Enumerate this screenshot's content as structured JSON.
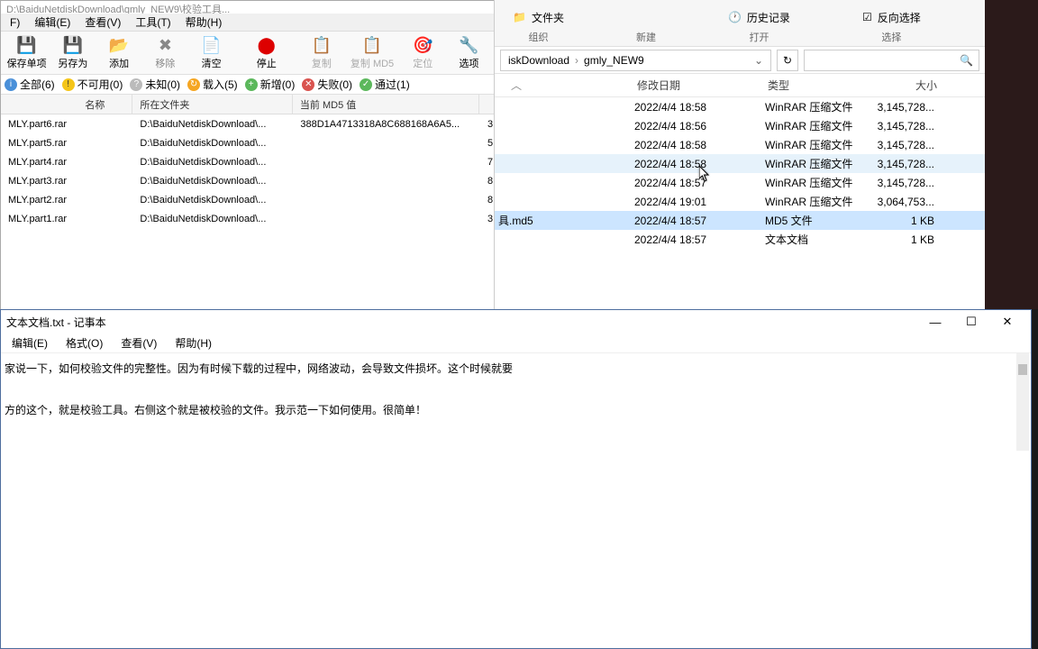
{
  "md5checker": {
    "title_fragment": "D:\\BaiduNetdiskDownload\\gmly_NEW9\\校验工具...",
    "menu": {
      "file": "F)",
      "edit": "编辑(E)",
      "view": "查看(V)",
      "tools": "工具(T)",
      "help": "帮助(H)"
    },
    "toolbar": {
      "save_single": "保存单项",
      "save_as": "另存为",
      "add": "添加",
      "remove": "移除",
      "clear": "清空",
      "stop": "停止",
      "copy": "复制",
      "copy_md5": "复制 MD5",
      "locate": "定位",
      "options": "选项"
    },
    "filter": {
      "all": "全部(6)",
      "na": "不可用(0)",
      "unknown": "未知(0)",
      "loaded": "载入(5)",
      "new": "新增(0)",
      "fail": "失败(0)",
      "pass": "通过(1)"
    },
    "columns": {
      "name": "名称",
      "folder": "所在文件夹",
      "md5": "当前 MD5 值"
    },
    "rows": [
      {
        "name": "MLY.part6.rar",
        "folder": "D:\\BaiduNetdiskDownload\\...",
        "md5": "388D1A4713318A8C688168A6A5...",
        "last": "3"
      },
      {
        "name": "MLY.part5.rar",
        "folder": "D:\\BaiduNetdiskDownload\\...",
        "md5": "",
        "last": "5"
      },
      {
        "name": "MLY.part4.rar",
        "folder": "D:\\BaiduNetdiskDownload\\...",
        "md5": "",
        "last": "7"
      },
      {
        "name": "MLY.part3.rar",
        "folder": "D:\\BaiduNetdiskDownload\\...",
        "md5": "",
        "last": "8"
      },
      {
        "name": "MLY.part2.rar",
        "folder": "D:\\BaiduNetdiskDownload\\...",
        "md5": "",
        "last": "8"
      },
      {
        "name": "MLY.part1.rar",
        "folder": "D:\\BaiduNetdiskDownload\\...",
        "md5": "",
        "last": "3"
      }
    ]
  },
  "explorer": {
    "top_groups": {
      "folder_label": "文件夹",
      "history": "历史记录",
      "invert": "反向选择",
      "organize": "组织",
      "new": "新建",
      "open": "打开",
      "select": "选择"
    },
    "breadcrumb": {
      "part1": "iskDownload",
      "part2": "gmly_NEW9"
    },
    "columns": {
      "date": "修改日期",
      "type": "类型",
      "size": "大小"
    },
    "rows": [
      {
        "date": "2022/4/4 18:58",
        "type": "WinRAR 压缩文件",
        "size": "3,145,728..."
      },
      {
        "date": "2022/4/4 18:56",
        "type": "WinRAR 压缩文件",
        "size": "3,145,728..."
      },
      {
        "date": "2022/4/4 18:58",
        "type": "WinRAR 压缩文件",
        "size": "3,145,728..."
      },
      {
        "date": "2022/4/4 18:58",
        "type": "WinRAR 压缩文件",
        "size": "3,145,728..."
      },
      {
        "date": "2022/4/4 18:57",
        "type": "WinRAR 压缩文件",
        "size": "3,145,728..."
      },
      {
        "date": "2022/4/4 19:01",
        "type": "WinRAR 压缩文件",
        "size": "3,064,753..."
      },
      {
        "name": "具.md5",
        "date": "2022/4/4 18:57",
        "type": "MD5 文件",
        "size": "1 KB"
      },
      {
        "date": "2022/4/4 18:57",
        "type": "文本文档",
        "size": "1 KB"
      }
    ]
  },
  "notepad": {
    "title": "文本文档.txt - 记事本",
    "menu": {
      "edit": "编辑(E)",
      "format": "格式(O)",
      "view": "查看(V)",
      "help": "帮助(H)"
    },
    "line1": "家说一下，如何校验文件的完整性。因为有时候下载的过程中，网络波动，会导致文件损坏。这个时候就要",
    "line2": "方的这个，就是校验工具。右侧这个就是被校验的文件。我示范一下如何使用。很简单！"
  }
}
